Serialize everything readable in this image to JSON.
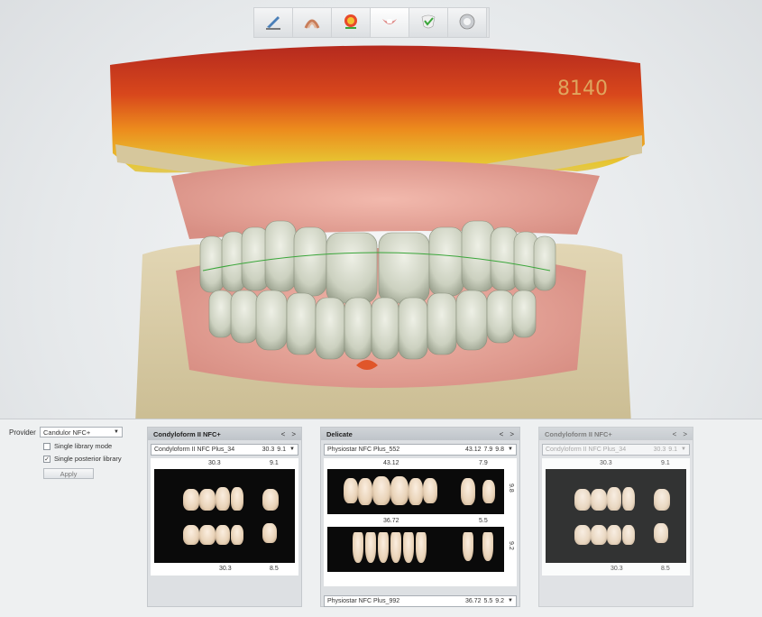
{
  "toolbar": {
    "tools": [
      {
        "icon": "scalpel-trim-icon"
      },
      {
        "icon": "anatomy-arch-icon"
      },
      {
        "icon": "color-map-icon"
      },
      {
        "icon": "teeth-setup-icon"
      },
      {
        "icon": "gingiva-icon"
      },
      {
        "icon": "finish-icon"
      }
    ],
    "active_index": 3
  },
  "scene": {
    "watermark": "8140"
  },
  "provider": {
    "label": "Provider",
    "value": "Candulor NFC+",
    "single_library_mode": {
      "label": "Single library mode",
      "checked": false
    },
    "single_posterior_library": {
      "label": "Single posterior library",
      "checked": true,
      "mark": "✓"
    },
    "apply_label": "Apply"
  },
  "libraries": [
    {
      "title": "Condyloform II NFC+",
      "prev": "<",
      "next": ">",
      "select": {
        "model": "Condyloform II NFC Plus_34",
        "v1": "30.3",
        "v2": "9.1",
        "v3": ""
      },
      "top_dims": {
        "a": "30.3",
        "b": "9.1"
      },
      "bottom_dims": {
        "a": "30.3",
        "b": "8.5"
      },
      "enabled": true
    },
    {
      "title": "Delicate",
      "prev": "<",
      "next": ">",
      "select": {
        "model": "Physiostar NFC Plus_552",
        "v1": "43.12",
        "v2": "7.9",
        "v3": "9.8"
      },
      "top_dims": {
        "a": "43.12",
        "b": "7.9"
      },
      "side_top": "9.8",
      "mid_dims": {
        "a": "36.72",
        "b": "5.5"
      },
      "side_bottom": "9.2",
      "bottom_select": {
        "model": "Physiostar NFC Plus_992",
        "v1": "36.72",
        "v2": "5.5",
        "v3": "9.2"
      },
      "enabled": true
    },
    {
      "title": "Condyloform II NFC+",
      "prev": "<",
      "next": ">",
      "select": {
        "model": "Condyloform II NFC Plus_34",
        "v1": "30.3",
        "v2": "9.1",
        "v3": ""
      },
      "top_dims": {
        "a": "30.3",
        "b": "9.1"
      },
      "bottom_dims": {
        "a": "30.3",
        "b": "8.5"
      },
      "enabled": false
    }
  ],
  "caret": "▼"
}
